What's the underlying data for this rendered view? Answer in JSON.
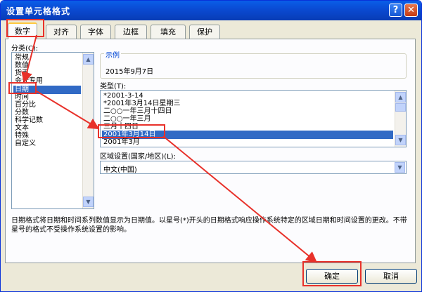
{
  "window": {
    "title": "设置单元格格式",
    "help_glyph": "?",
    "close_glyph": "✕"
  },
  "tabs": [
    {
      "label": "数字",
      "active": true
    },
    {
      "label": "对齐",
      "active": false
    },
    {
      "label": "字体",
      "active": false
    },
    {
      "label": "边框",
      "active": false
    },
    {
      "label": "填充",
      "active": false
    },
    {
      "label": "保护",
      "active": false
    }
  ],
  "category": {
    "label": "分类(C):",
    "items": [
      "常规",
      "数值",
      "货币",
      "会计专用",
      "日期",
      "时间",
      "百分比",
      "分数",
      "科学记数",
      "文本",
      "特殊",
      "自定义"
    ],
    "selected": "日期"
  },
  "sample": {
    "legend": "示例",
    "value": "2015年9月7日"
  },
  "type": {
    "label": "类型(T):",
    "items": [
      "*2001-3-14",
      "*2001年3月14日星期三",
      "二○○一年三月十四日",
      "二○○一年三月",
      "三月十四日",
      "2001年3月14日",
      "2001年3月"
    ],
    "selected": "2001年3月14日"
  },
  "locale": {
    "label": "区域设置(国家/地区)(L):",
    "value": "中文(中国)"
  },
  "description": "日期格式将日期和时间系列数值显示为日期值。以星号(*)开头的日期格式响应操作系统特定的区域日期和时间设置的更改。不带星号的格式不受操作系统设置的影响。",
  "buttons": {
    "ok": "确定",
    "cancel": "取消"
  },
  "icons": {
    "scroll_up": "▲",
    "scroll_down": "▼"
  },
  "colors": {
    "annotation": "#e8312a",
    "selection": "#316ac5",
    "titlebar": "#0a4ad2"
  }
}
